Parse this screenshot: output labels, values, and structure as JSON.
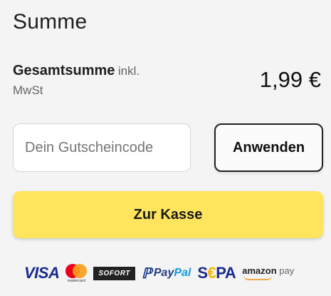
{
  "header": {
    "title": "Summe"
  },
  "summary": {
    "total_label": "Gesamtsumme",
    "tax_note_line1": "inkl.",
    "tax_note_line2": "MwSt",
    "total_amount": "1,99 €"
  },
  "voucher": {
    "placeholder": "Dein Gutscheincode",
    "value": "",
    "apply_label": "Anwenden"
  },
  "checkout": {
    "label": "Zur Kasse",
    "accent_color": "#ffe45e"
  },
  "payment_methods": {
    "visa": "VISA",
    "mastercard": "mastercard",
    "sofort": "SOFORT",
    "paypal_pay": "Pay",
    "paypal_pal": "Pal",
    "sepa_s": "S",
    "sepa_euro": "€",
    "sepa_pa": "PA",
    "amazon": "amazon",
    "amazon_pay": "pay"
  }
}
